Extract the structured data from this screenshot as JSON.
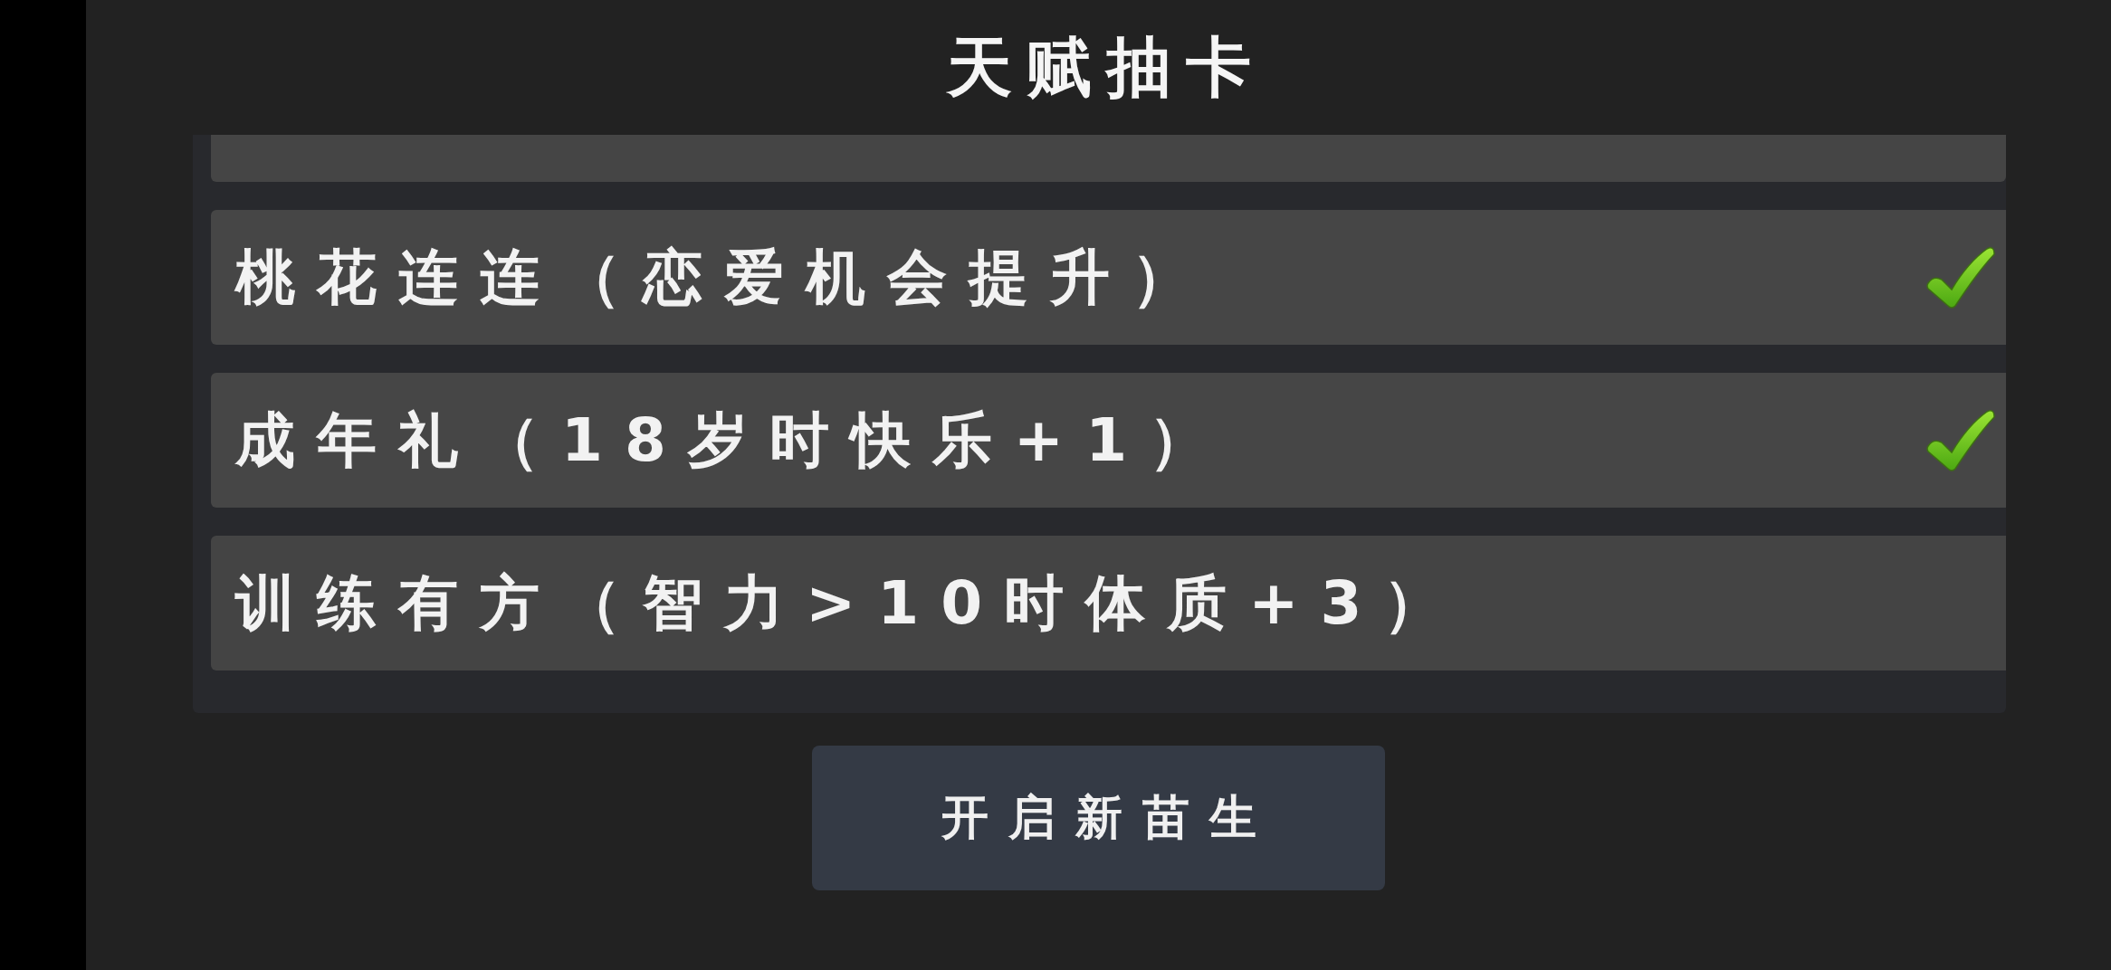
{
  "header": {
    "title": "天赋抽卡"
  },
  "talents": {
    "cut_row_above": true,
    "items": [
      {
        "text": "桃花连连（恋爱机会提升）",
        "checked": true
      },
      {
        "text": "成年礼（18岁时快乐+1）",
        "checked": true
      },
      {
        "text": "训练有方（智力>10时体质+3）",
        "checked": false
      }
    ]
  },
  "start_button": {
    "label": "开启新苗生"
  }
}
